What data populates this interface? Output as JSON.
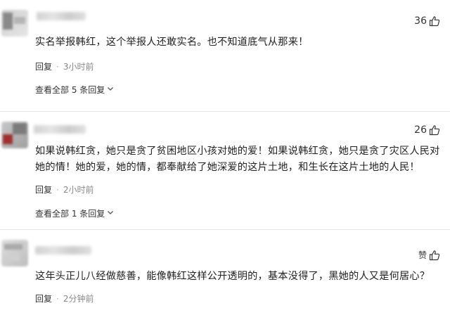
{
  "comments": [
    {
      "likes": "36",
      "text": "实名举报韩红，这个举报人还敢实名。也不知道底气从那来！",
      "reply_label": "回复",
      "separator": "·",
      "time": "3小时前",
      "view_all": "查看全部 5 条回复",
      "like_icon": "thumbs-up-icon"
    },
    {
      "likes": "26",
      "text": "如果说韩红贪，她只是贪了贫困地区小孩对她的爱！如果说韩红贪，她只是贪了灾区人民对她的情！她的爱，她的情，都奉献给了她深爱的这片土地，和生长在这片土地的人民！",
      "reply_label": "回复",
      "separator": "·",
      "time": "2小时前",
      "view_all": "查看全部 1 条回复",
      "like_icon": "thumbs-up-icon"
    },
    {
      "likes": "赞",
      "text": "这年头正儿八经做慈善，能像韩红这样公开透明的，基本没得了，黑她的人又是何居心？",
      "reply_label": "回复",
      "separator": "·",
      "time": "2分钟前",
      "like_icon": "thumbs-up-icon"
    }
  ],
  "colors": {
    "text": "#222222",
    "time": "#888888",
    "divider": "#e8e8e8"
  }
}
